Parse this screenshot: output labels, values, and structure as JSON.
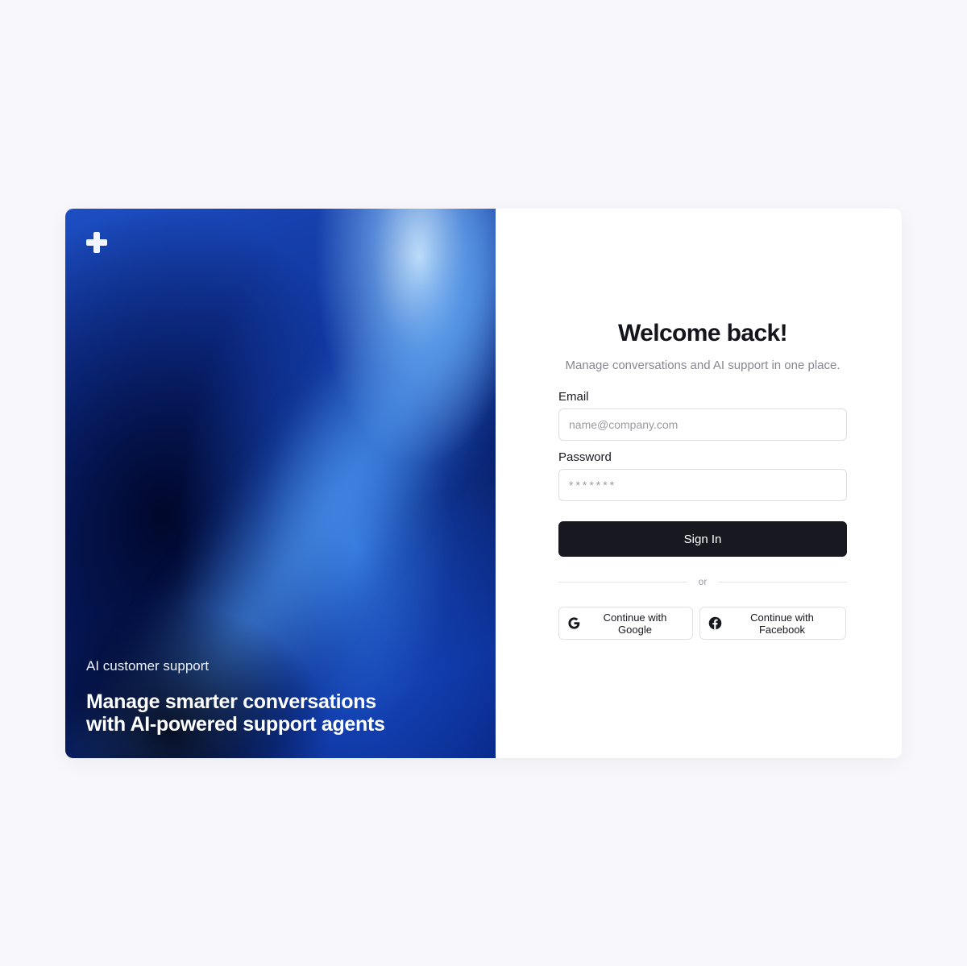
{
  "hero": {
    "eyebrow": "AI customer support",
    "headline": "Manage smarter conversations with AI-powered support agents",
    "logo_icon": "plus-cross-logo-icon"
  },
  "form": {
    "title": "Welcome back!",
    "subtitle": "Manage conversations and AI support in one place.",
    "email": {
      "label": "Email",
      "placeholder": "name@company.com",
      "value": ""
    },
    "password": {
      "label": "Password",
      "placeholder": "*******",
      "value": ""
    },
    "sign_in_label": "Sign In",
    "divider_text": "or",
    "google_label": "Continue with Google",
    "facebook_label": "Continue with Facebook"
  },
  "colors": {
    "page_background": "#f8f7fb",
    "primary_button": "#181820",
    "hero_blue": "#0b2a8a"
  }
}
